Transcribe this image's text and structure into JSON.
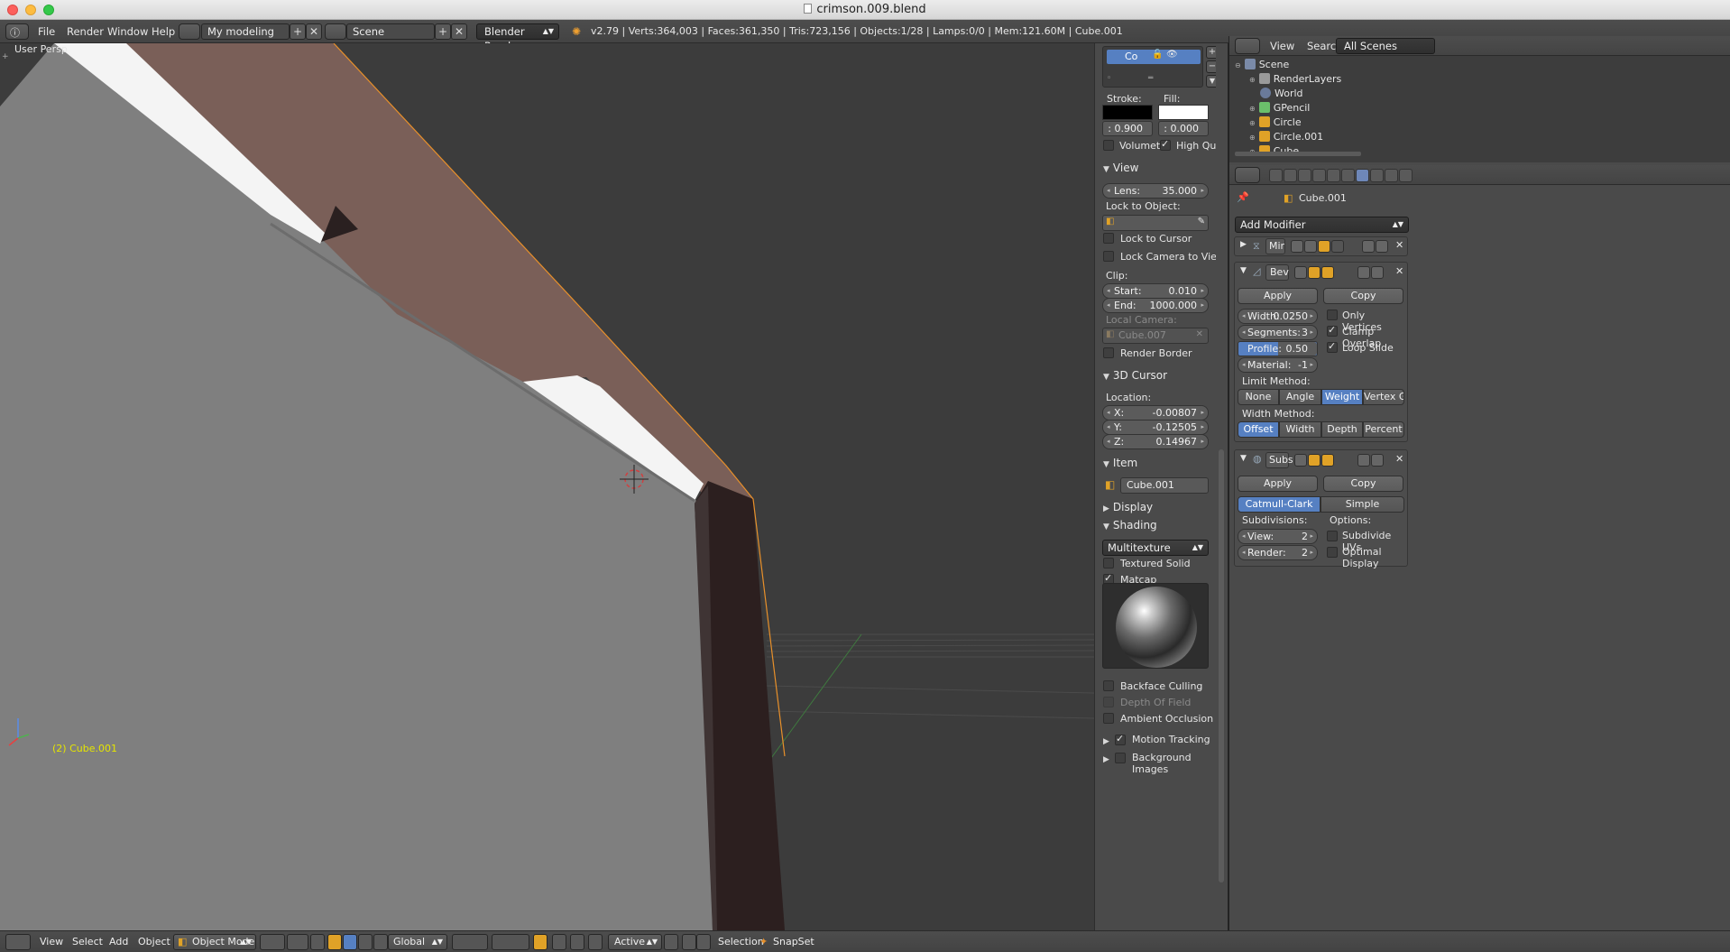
{
  "window": {
    "title": "crimson.009.blend"
  },
  "infobar": {
    "menus": [
      "File",
      "Render",
      "Window",
      "Help"
    ],
    "screen_layout": "My modeling",
    "scene": "Scene",
    "render_engine": "Blender Render",
    "stats": "v2.79 | Verts:364,003 | Faces:361,350 | Tris:723,156 | Objects:1/28 | Lamps:0/0 | Mem:121.60M | Cube.001"
  },
  "viewport": {
    "view_name": "User Persp",
    "object_label": "(2) Cube.001",
    "colors": {
      "background": "#3c3c3c",
      "floor": "#808080",
      "wall_top": "#7a5f58",
      "wall_dark": "#2b1e1e",
      "selection_outline": "#f0a030"
    }
  },
  "npanel": {
    "gp_layer_tab": "Co",
    "stroke_label": "Stroke:",
    "fill_label": "Fill:",
    "stroke_value": ": 0.900",
    "fill_value": ": 0.000",
    "volumetric": "Volumet",
    "high_quality": "High Qu",
    "view_header": "View",
    "lens_label": "Lens:",
    "lens_value": "35.000",
    "lock_to_object": "Lock to Object:",
    "lock_to_cursor": "Lock to Cursor",
    "lock_camera": "Lock Camera to View",
    "clip_label": "Clip:",
    "clip_start_label": "Start:",
    "clip_start": "0.010",
    "clip_end_label": "End:",
    "clip_end": "1000.000",
    "local_camera_label": "Local Camera:",
    "local_camera": "Cube.007",
    "render_border": "Render Border",
    "cursor_header": "3D Cursor",
    "location_label": "Location:",
    "cursor_x_label": "X:",
    "cursor_x": "-0.00807",
    "cursor_y_label": "Y:",
    "cursor_y": "-0.12505",
    "cursor_z_label": "Z:",
    "cursor_z": "0.14967",
    "item_header": "Item",
    "item_name": "Cube.001",
    "display_header": "Display",
    "shading_header": "Shading",
    "shading_mode": "Multitexture",
    "textured_solid": "Textured Solid",
    "matcap": "Matcap",
    "backface_culling": "Backface Culling",
    "depth_of_field": "Depth Of Field",
    "ambient_occlusion": "Ambient Occlusion",
    "motion_tracking": "Motion Tracking",
    "background_images": "Background Images"
  },
  "outliner": {
    "menus": [
      "View",
      "Search"
    ],
    "filter": "All Scenes",
    "rows": [
      "Scene",
      "RenderLayers",
      "World",
      "GPencil",
      "Circle",
      "Circle.001",
      "Cube"
    ]
  },
  "properties": {
    "object_name": "Cube.001",
    "add_modifier": "Add Modifier",
    "mirror": {
      "name": "Mir"
    },
    "bevel": {
      "name": "Bev",
      "apply": "Apply",
      "copy": "Copy",
      "width_label": "Width:",
      "width": "0.0250",
      "segments_label": "Segments:",
      "segments": "3",
      "profile_label": "Profile:",
      "profile": "0.50",
      "material_label": "Material:",
      "material": "-1",
      "only_vertices": "Only Vertices",
      "clamp_overlap": "Clamp Overlap",
      "loop_slide": "Loop Slide",
      "limit_method_label": "Limit Method:",
      "limit_methods": [
        "None",
        "Angle",
        "Weight",
        "Vertex G..."
      ],
      "limit_selected": "Weight",
      "width_method_label": "Width Method:",
      "width_methods": [
        "Offset",
        "Width",
        "Depth",
        "Percent"
      ],
      "width_selected": "Offset"
    },
    "subsurf": {
      "name": "Subs",
      "apply": "Apply",
      "copy": "Copy",
      "types": [
        "Catmull-Clark",
        "Simple"
      ],
      "type_selected": "Catmull-Clark",
      "subdivisions_label": "Subdivisions:",
      "options_label": "Options:",
      "view_label": "View:",
      "view": "2",
      "render_label": "Render:",
      "render": "2",
      "subdivide_uvs": "Subdivide UVs",
      "optimal_display": "Optimal Display"
    }
  },
  "bottombar": {
    "menus": [
      "View",
      "Select",
      "Add",
      "Object"
    ],
    "mode": "Object Mode",
    "orientation": "Global",
    "pivot_active": "Active",
    "selection": "Selection",
    "snapset": "SnapSet"
  }
}
